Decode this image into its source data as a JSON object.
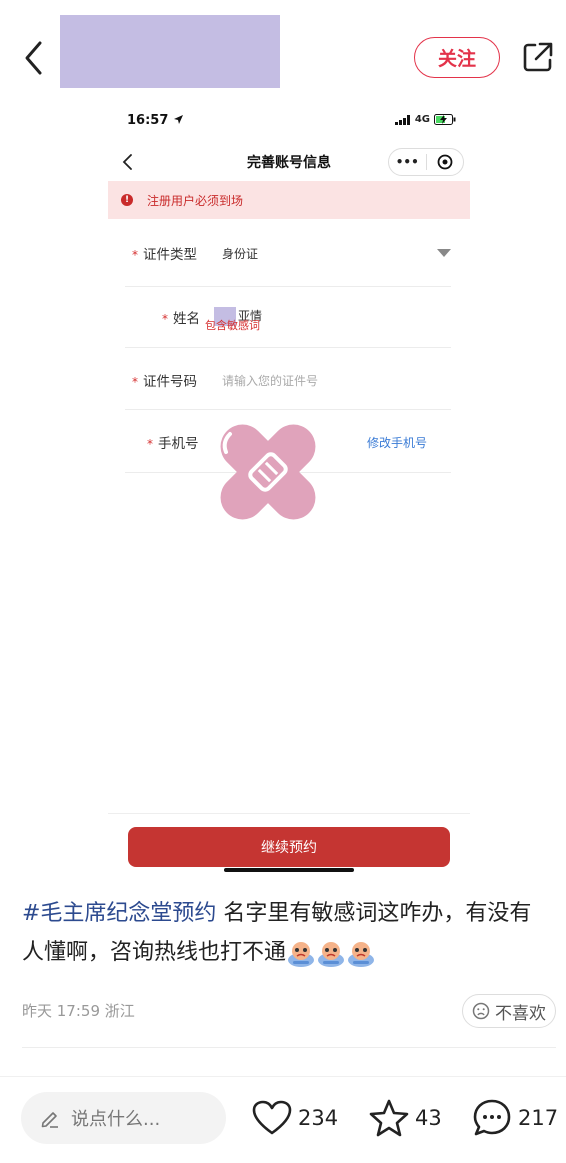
{
  "header": {
    "follow_label": "关注"
  },
  "screenshot": {
    "status_time": "16:57",
    "network": "4G",
    "title": "完善账号信息",
    "capsule_more": "•••",
    "alert_icon": "!",
    "alert_text": "注册用户必须到场",
    "fields": {
      "id_type": {
        "label": "证件类型",
        "value": "身份证"
      },
      "name": {
        "label": "姓名",
        "value_suffix": "亚情",
        "error": "包含敏感词"
      },
      "id_number": {
        "label": "证件号码",
        "placeholder": "请输入您的证件号"
      },
      "phone": {
        "label": "手机号",
        "link": "修改手机号"
      }
    },
    "required_mark": "*",
    "continue_label": "继续预约"
  },
  "post": {
    "hashtag": "#毛主席纪念堂预约",
    "text": " 名字里有敏感词这咋办，有没有人懂啊，咨询热线也打不通",
    "time": "昨天 17:59",
    "location": "浙江",
    "dislike_label": "不喜欢"
  },
  "bottombar": {
    "comment_placeholder": "说点什么...",
    "likes": "234",
    "stars": "43",
    "comments": "217"
  },
  "colors": {
    "accent_red": "#e3334a",
    "button_red": "#c53532",
    "hashtag_blue": "#2c4a8f",
    "redaction": "#c4bde3"
  },
  "icons": [
    "chevron-left-icon",
    "share-icon",
    "location-arrow-icon",
    "signal-icon",
    "battery-icon",
    "more-icon",
    "target-icon",
    "alert-icon",
    "dropdown-arrow-icon",
    "bandage-sticker-icon",
    "crying-emoji-icon",
    "sad-face-icon",
    "pencil-icon",
    "heart-icon",
    "star-icon",
    "comment-icon"
  ]
}
